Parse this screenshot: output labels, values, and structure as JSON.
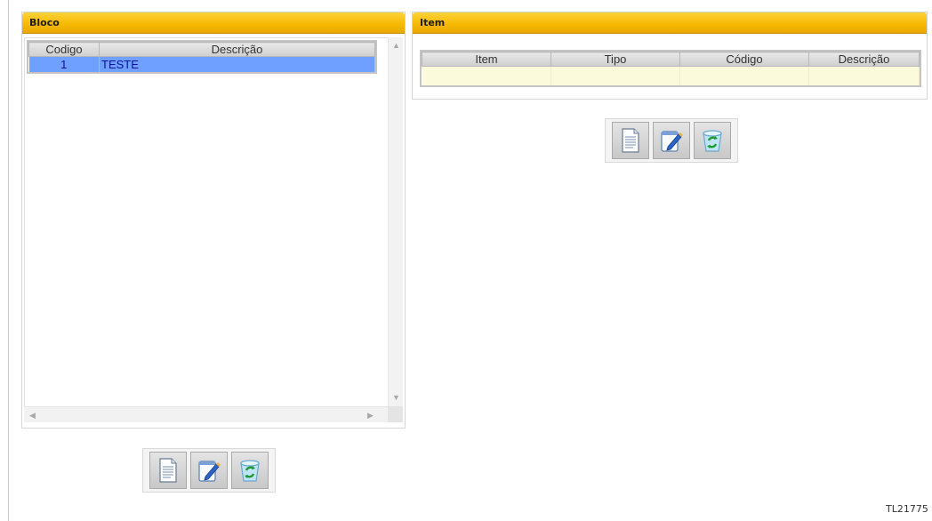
{
  "bloco": {
    "title": "Bloco",
    "columns": [
      "Codigo",
      "Descrição"
    ],
    "rows": [
      {
        "codigo": "1",
        "descricao": "TESTE"
      }
    ]
  },
  "item": {
    "title": "Item",
    "columns": [
      "Item",
      "Tipo",
      "Código",
      "Descrição"
    ]
  },
  "toolbar_icons": [
    "new-document-icon",
    "edit-icon",
    "delete-recycle-icon"
  ],
  "colors": {
    "header_gold": "#f6b800",
    "selected_row": "#6fa0ff",
    "selected_text": "#0b10a0",
    "item_row": "#fbfbdb"
  },
  "footer": {
    "code": "TL21775"
  }
}
